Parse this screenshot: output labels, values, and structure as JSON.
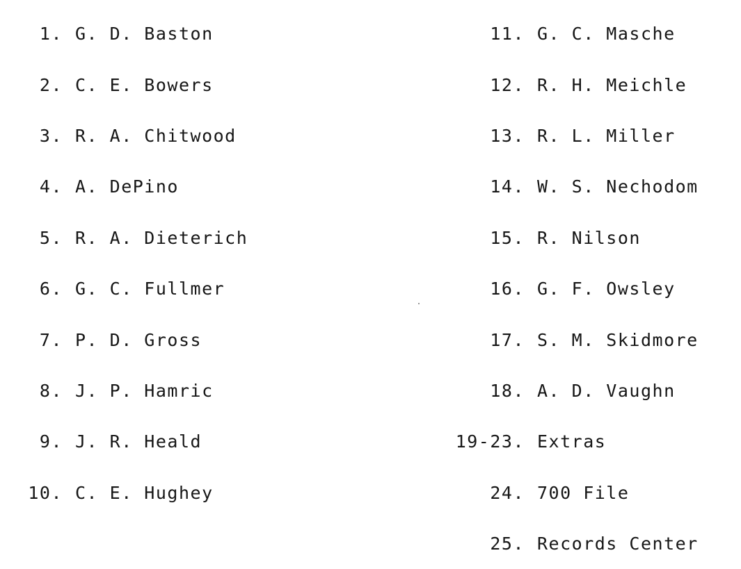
{
  "distribution_list": {
    "left_column": [
      {
        "number": "1.",
        "name": "G. D. Baston"
      },
      {
        "number": "2.",
        "name": "C. E. Bowers"
      },
      {
        "number": "3.",
        "name": "R. A. Chitwood"
      },
      {
        "number": "4.",
        "name": "A. DePino"
      },
      {
        "number": "5.",
        "name": "R. A. Dieterich"
      },
      {
        "number": "6.",
        "name": "G. C. Fullmer"
      },
      {
        "number": "7.",
        "name": "P. D. Gross"
      },
      {
        "number": "8.",
        "name": "J. P. Hamric"
      },
      {
        "number": "9.",
        "name": "J. R. Heald"
      },
      {
        "number": "10.",
        "name": "C. E. Hughey"
      }
    ],
    "right_column": [
      {
        "number": "11.",
        "name": "G. C. Masche"
      },
      {
        "number": "12.",
        "name": "R. H. Meichle"
      },
      {
        "number": "13.",
        "name": "R. L. Miller"
      },
      {
        "number": "14.",
        "name": "W. S. Nechodom"
      },
      {
        "number": "15.",
        "name": "R. Nilson"
      },
      {
        "number": "16.",
        "name": "G. F. Owsley"
      },
      {
        "number": "17.",
        "name": "S. M. Skidmore"
      },
      {
        "number": "18.",
        "name": "A. D. Vaughn"
      },
      {
        "number": "19-23.",
        "name": "Extras"
      },
      {
        "number": "24.",
        "name": "700 File"
      },
      {
        "number": "25.",
        "name": "Records Center"
      }
    ]
  }
}
